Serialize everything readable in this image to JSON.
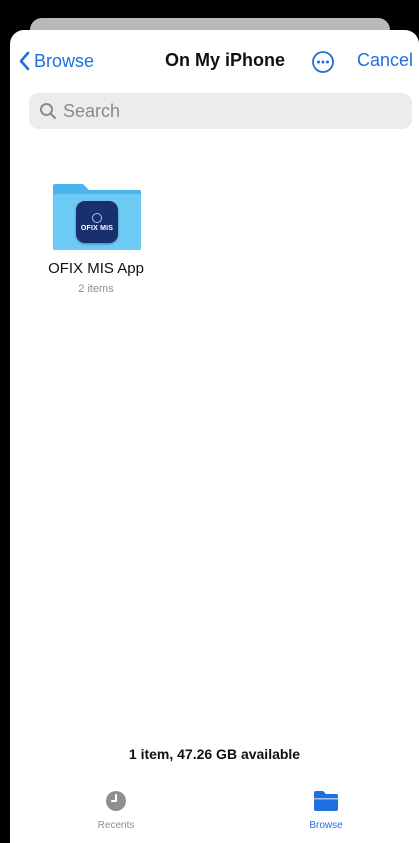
{
  "nav": {
    "back_label": "Browse",
    "title": "On My iPhone",
    "cancel_label": "Cancel"
  },
  "search": {
    "placeholder": "Search"
  },
  "items": [
    {
      "name": "OFIX MIS App",
      "meta": "2 items",
      "icon_text": "OFIX MIS"
    }
  ],
  "footer": {
    "storage": "1 item, 47.26 GB available"
  },
  "tabs": [
    {
      "label": "Recents",
      "icon": "clock-icon",
      "active": false
    },
    {
      "label": "Browse",
      "icon": "folder-icon",
      "active": true
    }
  ],
  "colors": {
    "accent": "#1f6fe0",
    "folder": "#5ec3f2",
    "app_icon_bg": "#19306f"
  }
}
